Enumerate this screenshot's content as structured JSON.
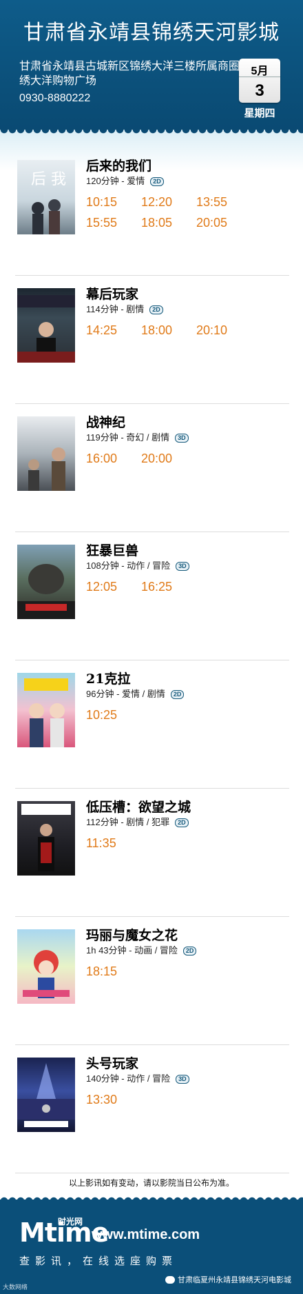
{
  "header": {
    "title": "甘肃省永靖县锦绣天河影城",
    "address": "甘肃省永靖县古城新区锦绣大洋三楼所属商圈锦绣大洋购物广场",
    "phone": "0930-8880222",
    "month": "5月",
    "day": "3",
    "weekday": "星期四"
  },
  "colors": {
    "header_bg": "#0b4f79",
    "time_color": "#e07a18"
  },
  "movies": [
    {
      "title": "后来的我们",
      "meta": "120分钟 - 爱情",
      "format": "2D",
      "times": [
        "10:15",
        "12:20",
        "13:55",
        "15:55",
        "18:05",
        "20:05"
      ]
    },
    {
      "title": "幕后玩家",
      "meta": "114分钟 - 剧情",
      "format": "2D",
      "times": [
        "14:25",
        "18:00",
        "20:10"
      ]
    },
    {
      "title": "战神纪",
      "meta": "119分钟 - 奇幻 / 剧情",
      "format": "3D",
      "times": [
        "16:00",
        "20:00"
      ]
    },
    {
      "title": "狂暴巨兽",
      "meta": "108分钟 - 动作 / 冒险",
      "format": "3D",
      "times": [
        "12:05",
        "16:25"
      ]
    },
    {
      "title": "21克拉",
      "meta": "96分钟 - 爱情 / 剧情",
      "format": "2D",
      "times": [
        "10:25"
      ]
    },
    {
      "title": "低压槽：欲望之城",
      "meta": "112分钟 - 剧情 / 犯罪",
      "format": "2D",
      "times": [
        "11:35"
      ]
    },
    {
      "title": "玛丽与魔女之花",
      "meta": "1h 43分钟 - 动画 / 冒险",
      "format": "2D",
      "times": [
        "18:15"
      ]
    },
    {
      "title": "头号玩家",
      "meta": "140分钟 - 动作 / 冒险",
      "format": "3D",
      "times": [
        "13:30"
      ]
    }
  ],
  "notice": "以上影讯如有变动，请以影院当日公布为准。",
  "footer": {
    "logo": "Mtime",
    "logo_cn": "时光网",
    "site": "www.mtime.com",
    "slogan": "查影讯，在线选座购票",
    "wechat": "甘肃临夏州永靖县锦绣天河电影城",
    "corner": "大数网络"
  }
}
